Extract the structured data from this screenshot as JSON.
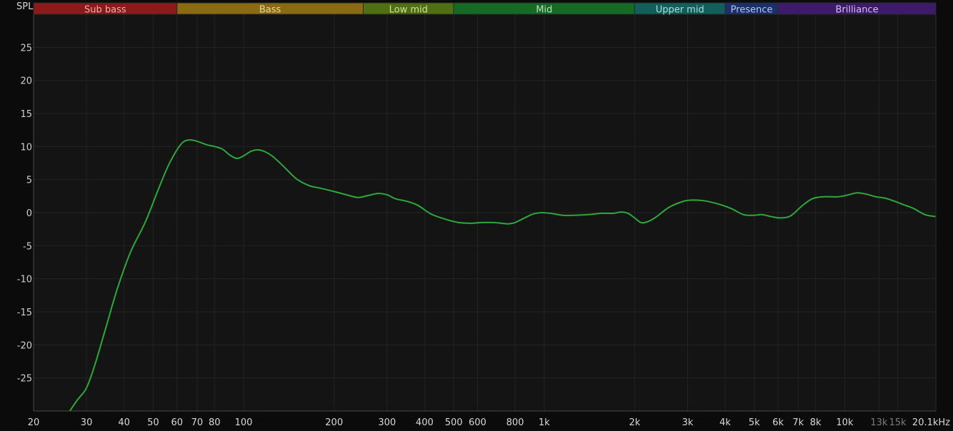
{
  "chart_data": {
    "type": "line",
    "title": "",
    "ylabel": "SPL",
    "xlabel": "",
    "x_scale": "log",
    "xlim": [
      20,
      20100
    ],
    "ylim": [
      -30,
      30
    ],
    "grid": true,
    "y_ticks": [
      25,
      20,
      15,
      10,
      5,
      0,
      -5,
      -10,
      -15,
      -20,
      -25
    ],
    "x_ticks": [
      {
        "value": 20,
        "label": "20",
        "dim": false
      },
      {
        "value": 30,
        "label": "30",
        "dim": false
      },
      {
        "value": 40,
        "label": "40",
        "dim": false
      },
      {
        "value": 50,
        "label": "50",
        "dim": false
      },
      {
        "value": 60,
        "label": "60",
        "dim": false
      },
      {
        "value": 70,
        "label": "70",
        "dim": false
      },
      {
        "value": 80,
        "label": "80",
        "dim": false
      },
      {
        "value": 100,
        "label": "100",
        "dim": false
      },
      {
        "value": 200,
        "label": "200",
        "dim": false
      },
      {
        "value": 300,
        "label": "300",
        "dim": false
      },
      {
        "value": 400,
        "label": "400",
        "dim": false
      },
      {
        "value": 500,
        "label": "500",
        "dim": false
      },
      {
        "value": 600,
        "label": "600",
        "dim": false
      },
      {
        "value": 800,
        "label": "800",
        "dim": false
      },
      {
        "value": 1000,
        "label": "1k",
        "dim": false
      },
      {
        "value": 2000,
        "label": "2k",
        "dim": false
      },
      {
        "value": 3000,
        "label": "3k",
        "dim": false
      },
      {
        "value": 4000,
        "label": "4k",
        "dim": false
      },
      {
        "value": 5000,
        "label": "5k",
        "dim": false
      },
      {
        "value": 6000,
        "label": "6k",
        "dim": false
      },
      {
        "value": 7000,
        "label": "7k",
        "dim": false
      },
      {
        "value": 8000,
        "label": "8k",
        "dim": false
      },
      {
        "value": 10000,
        "label": "10k",
        "dim": false
      },
      {
        "value": 13000,
        "label": "13k",
        "dim": true
      },
      {
        "value": 15000,
        "label": "15k",
        "dim": true
      },
      {
        "value": 20100,
        "label": "20.1kHz",
        "dim": false
      }
    ],
    "bands": [
      {
        "name": "Sub bass",
        "start": 20,
        "end": 60,
        "color": "#8b1a1a",
        "text_color": "#e8b0b0"
      },
      {
        "name": "Bass",
        "start": 60,
        "end": 250,
        "color": "#8a6a12",
        "text_color": "#e6d6a0"
      },
      {
        "name": "Low mid",
        "start": 250,
        "end": 500,
        "color": "#4f6f12",
        "text_color": "#cfe0a0"
      },
      {
        "name": "Mid",
        "start": 500,
        "end": 2000,
        "color": "#166b24",
        "text_color": "#b8e0bf"
      },
      {
        "name": "Upper mid",
        "start": 2000,
        "end": 4000,
        "color": "#125e5a",
        "text_color": "#aedcd8"
      },
      {
        "name": "Presence",
        "start": 4000,
        "end": 6000,
        "color": "#1b2f6b",
        "text_color": "#b6c4ec"
      },
      {
        "name": "Brilliance",
        "start": 6000,
        "end": 20100,
        "color": "#3d1a6a",
        "text_color": "#d2bfee"
      }
    ],
    "series": [
      {
        "color": "#2ea83a",
        "points": [
          [
            26.4,
            -30
          ],
          [
            28,
            -28.3
          ],
          [
            30,
            -26.5
          ],
          [
            32,
            -23
          ],
          [
            35,
            -17
          ],
          [
            38,
            -11.5
          ],
          [
            42,
            -6
          ],
          [
            47,
            -1.5
          ],
          [
            52,
            3.5
          ],
          [
            56,
            7
          ],
          [
            60,
            9.5
          ],
          [
            63,
            10.7
          ],
          [
            66,
            11.0
          ],
          [
            70,
            10.8
          ],
          [
            75,
            10.3
          ],
          [
            80,
            10.0
          ],
          [
            85,
            9.6
          ],
          [
            90,
            8.7
          ],
          [
            95,
            8.2
          ],
          [
            100,
            8.6
          ],
          [
            106,
            9.3
          ],
          [
            112,
            9.5
          ],
          [
            118,
            9.2
          ],
          [
            125,
            8.5
          ],
          [
            135,
            7.1
          ],
          [
            150,
            5.1
          ],
          [
            165,
            4.1
          ],
          [
            180,
            3.7
          ],
          [
            200,
            3.2
          ],
          [
            220,
            2.7
          ],
          [
            240,
            2.3
          ],
          [
            260,
            2.6
          ],
          [
            280,
            2.9
          ],
          [
            300,
            2.7
          ],
          [
            320,
            2.1
          ],
          [
            350,
            1.7
          ],
          [
            380,
            1.1
          ],
          [
            420,
            -0.2
          ],
          [
            470,
            -1.0
          ],
          [
            520,
            -1.5
          ],
          [
            570,
            -1.6
          ],
          [
            620,
            -1.5
          ],
          [
            680,
            -1.5
          ],
          [
            720,
            -1.6
          ],
          [
            760,
            -1.7
          ],
          [
            800,
            -1.5
          ],
          [
            860,
            -0.8
          ],
          [
            920,
            -0.2
          ],
          [
            980,
            0.0
          ],
          [
            1050,
            -0.1
          ],
          [
            1150,
            -0.4
          ],
          [
            1250,
            -0.4
          ],
          [
            1400,
            -0.3
          ],
          [
            1550,
            -0.1
          ],
          [
            1700,
            -0.1
          ],
          [
            1800,
            0.1
          ],
          [
            1900,
            -0.1
          ],
          [
            2000,
            -0.8
          ],
          [
            2100,
            -1.5
          ],
          [
            2200,
            -1.4
          ],
          [
            2350,
            -0.7
          ],
          [
            2600,
            0.8
          ],
          [
            2900,
            1.7
          ],
          [
            3100,
            1.9
          ],
          [
            3400,
            1.8
          ],
          [
            3800,
            1.3
          ],
          [
            4200,
            0.6
          ],
          [
            4600,
            -0.3
          ],
          [
            5000,
            -0.4
          ],
          [
            5300,
            -0.3
          ],
          [
            5700,
            -0.6
          ],
          [
            6100,
            -0.8
          ],
          [
            6600,
            -0.5
          ],
          [
            7200,
            1.0
          ],
          [
            7800,
            2.1
          ],
          [
            8500,
            2.4
          ],
          [
            9500,
            2.4
          ],
          [
            10300,
            2.7
          ],
          [
            11000,
            3.0
          ],
          [
            11800,
            2.8
          ],
          [
            12700,
            2.4
          ],
          [
            13600,
            2.2
          ],
          [
            14500,
            1.8
          ],
          [
            15700,
            1.2
          ],
          [
            17000,
            0.6
          ],
          [
            18500,
            -0.3
          ],
          [
            20100,
            -0.6
          ]
        ]
      }
    ]
  }
}
